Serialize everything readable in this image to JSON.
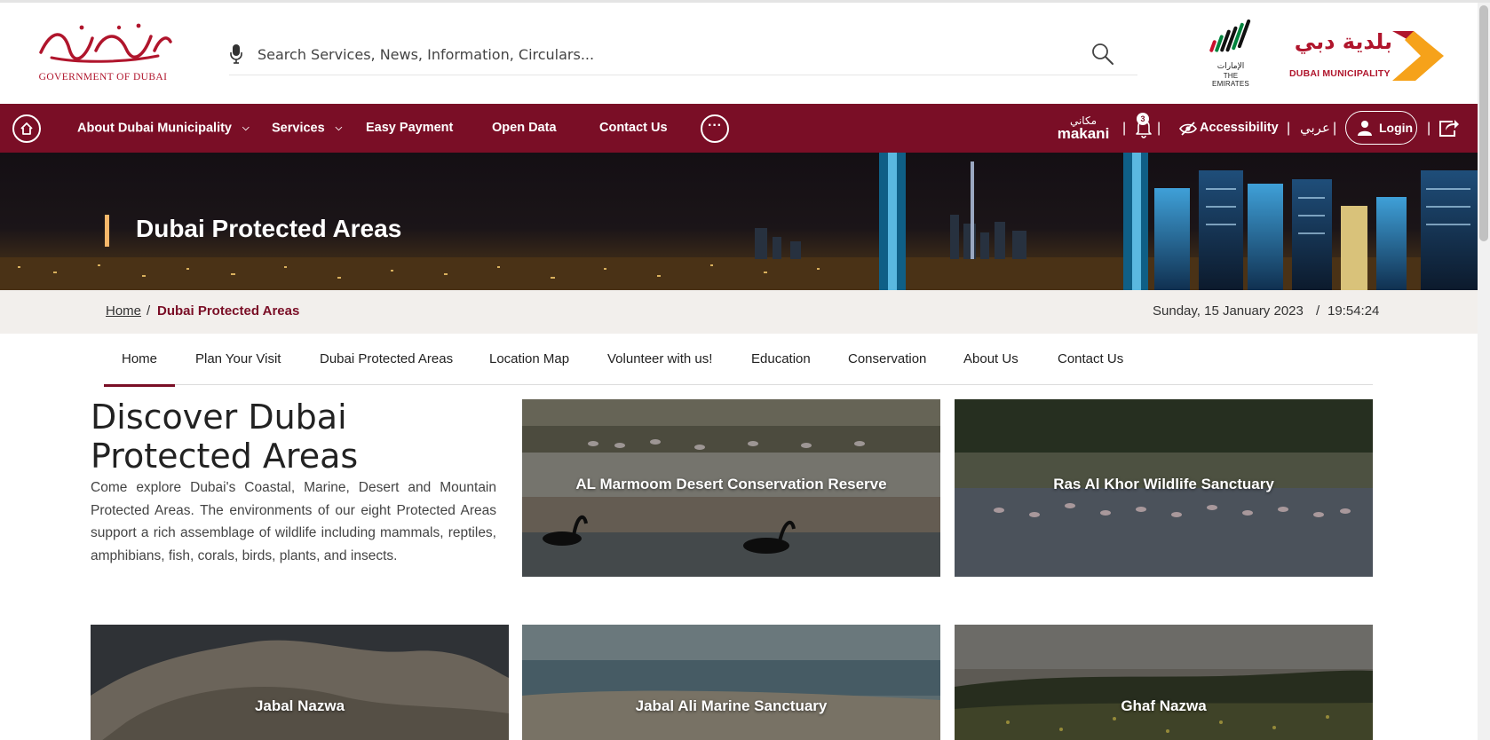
{
  "header": {
    "gov_logo_arabic": "حكومة دبي",
    "gov_logo_english": "GOVERNMENT OF DUBAI",
    "search_placeholder": "Search Services, News, Information, Circulars...",
    "uae_logo_arabic": "الإمارات",
    "uae_logo_english": "THE EMIRATES",
    "dm_logo_arabic": "بلدية دبي",
    "dm_logo_english": "DUBAI MUNICIPALITY"
  },
  "nav": {
    "items": [
      {
        "label": "About Dubai Municipality",
        "has_dropdown": true
      },
      {
        "label": "Services",
        "has_dropdown": true
      },
      {
        "label": "Easy Payment",
        "has_dropdown": false
      },
      {
        "label": "Open Data",
        "has_dropdown": false
      },
      {
        "label": "Contact Us",
        "has_dropdown": false
      }
    ],
    "more_label": "···",
    "makani_arabic": "مكاني",
    "makani_english": "makani",
    "notification_count": "3",
    "accessibility_label": "Accessibility",
    "arabic_label": "عربي",
    "login_label": "Login",
    "separator": "|"
  },
  "banner": {
    "title": "Dubai Protected Areas"
  },
  "breadcrumb": {
    "home": "Home",
    "separator": "/",
    "current": "Dubai Protected Areas",
    "date": "Sunday, 15 January 2023",
    "date_separator": "/",
    "time": "19:54:24"
  },
  "subtabs": [
    {
      "label": "Home",
      "active": true
    },
    {
      "label": "Plan Your Visit",
      "active": false
    },
    {
      "label": "Dubai Protected Areas",
      "active": false
    },
    {
      "label": "Location Map",
      "active": false
    },
    {
      "label": "Volunteer with us!",
      "active": false
    },
    {
      "label": "Education",
      "active": false
    },
    {
      "label": "Conservation",
      "active": false
    },
    {
      "label": "About Us",
      "active": false
    },
    {
      "label": "Contact Us",
      "active": false
    }
  ],
  "intro": {
    "title": "Discover Dubai Protected Areas",
    "text": "Come explore Dubai's Coastal, Marine, Desert and Mountain Protected Areas.  The environments of our eight Protected Areas support a rich assemblage of wildlife including mammals, reptiles, amphibians, fish, corals, birds, plants, and insects."
  },
  "cards": [
    {
      "label": "AL Marmoom Desert Conservation Reserve"
    },
    {
      "label": "Ras Al Khor Wildlife Sanctuary"
    },
    {
      "label": "Jabal Nazwa"
    },
    {
      "label": "Jabal Ali Marine Sanctuary"
    },
    {
      "label": "Ghaf Nazwa"
    }
  ],
  "colors": {
    "brand_maroon": "#7a0e26",
    "logo_red": "#b0152c",
    "accent_orange": "#f6a21a",
    "title_bar": "#f6b76a"
  },
  "icons": [
    "home-icon",
    "chevron-down-icon",
    "more-icon",
    "mic-icon",
    "search-icon",
    "bell-icon",
    "eye-slash-icon",
    "user-icon",
    "share-icon"
  ]
}
